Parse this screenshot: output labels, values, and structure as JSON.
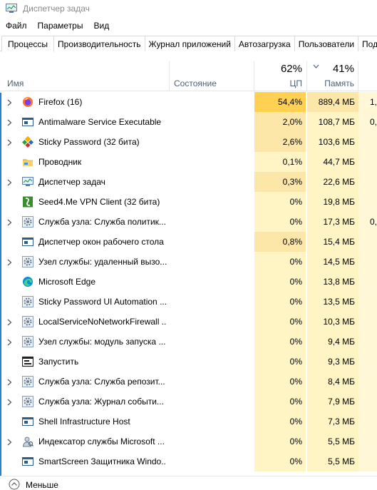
{
  "window": {
    "title": "Диспетчер задач",
    "icon": "task-manager-icon"
  },
  "menu": [
    {
      "label": "Файл"
    },
    {
      "label": "Параметры"
    },
    {
      "label": "Вид"
    }
  ],
  "tabs": [
    {
      "label": "Процессы",
      "active": true
    },
    {
      "label": "Производительность"
    },
    {
      "label": "Журнал приложений"
    },
    {
      "label": "Автозагрузка"
    },
    {
      "label": "Пользователи"
    },
    {
      "label": "Под"
    }
  ],
  "columns": {
    "name": "Имя",
    "status": "Состояние",
    "cpu_total": "62%",
    "cpu_label": "ЦП",
    "mem_total": "41%",
    "mem_label": "Память"
  },
  "colors": {
    "heat_high": "#ffd051",
    "heat_mid": "#fde7a8",
    "heat_low": "#fff4c4",
    "heat_edge": "#fff7d6"
  },
  "processes": [
    {
      "name": "Firefox (16)",
      "expandable": true,
      "icon": "firefox-icon",
      "cpu": "54,4%",
      "mem": "889,4 МБ",
      "extra": "1,",
      "cpu_heat": "high",
      "mem_heat": "mid"
    },
    {
      "name": "Antimalware Service Executable",
      "expandable": true,
      "icon": "service-window-icon",
      "cpu": "2,0%",
      "mem": "108,7 МБ",
      "extra": "0,",
      "cpu_heat": "mid",
      "mem_heat": "low"
    },
    {
      "name": "Sticky Password (32 бита)",
      "expandable": true,
      "icon": "sticky-password-icon",
      "cpu": "2,6%",
      "mem": "103,6 МБ",
      "extra": "",
      "cpu_heat": "mid",
      "mem_heat": "low"
    },
    {
      "name": "Проводник",
      "expandable": false,
      "icon": "folder-icon",
      "cpu": "0,1%",
      "mem": "44,7 МБ",
      "extra": "",
      "cpu_heat": "low",
      "mem_heat": "low"
    },
    {
      "name": "Диспетчер задач",
      "expandable": true,
      "icon": "task-manager-icon",
      "cpu": "0,3%",
      "mem": "22,6 МБ",
      "extra": "",
      "cpu_heat": "mid",
      "mem_heat": "low"
    },
    {
      "name": "Seed4.Me VPN Client (32 бита)",
      "expandable": false,
      "icon": "vpn-client-icon",
      "cpu": "0%",
      "mem": "19,8 МБ",
      "extra": "",
      "cpu_heat": "low",
      "mem_heat": "low"
    },
    {
      "name": "Служба узла: Служба политик...",
      "expandable": true,
      "icon": "gear-icon",
      "cpu": "0%",
      "mem": "17,3 МБ",
      "extra": "0,",
      "cpu_heat": "low",
      "mem_heat": "low"
    },
    {
      "name": "Диспетчер окон рабочего стола",
      "expandable": false,
      "icon": "service-window-icon",
      "cpu": "0,8%",
      "mem": "15,4 МБ",
      "extra": "",
      "cpu_heat": "mid",
      "mem_heat": "low"
    },
    {
      "name": "Узел службы: удаленный вызо...",
      "expandable": true,
      "icon": "gear-icon",
      "cpu": "0%",
      "mem": "14,5 МБ",
      "extra": "",
      "cpu_heat": "low",
      "mem_heat": "low"
    },
    {
      "name": "Microsoft Edge",
      "expandable": false,
      "icon": "edge-icon",
      "cpu": "0%",
      "mem": "13,8 МБ",
      "extra": "",
      "cpu_heat": "low",
      "mem_heat": "low"
    },
    {
      "name": "Sticky Password UI Automation ...",
      "expandable": false,
      "icon": "gear-icon",
      "cpu": "0%",
      "mem": "13,5 МБ",
      "extra": "",
      "cpu_heat": "low",
      "mem_heat": "low"
    },
    {
      "name": "LocalServiceNoNetworkFirewall ...",
      "expandable": true,
      "icon": "gear-icon",
      "cpu": "0%",
      "mem": "10,3 МБ",
      "extra": "",
      "cpu_heat": "low",
      "mem_heat": "low"
    },
    {
      "name": "Узел службы: модуль запуска ...",
      "expandable": true,
      "icon": "gear-icon",
      "cpu": "0%",
      "mem": "9,4 МБ",
      "extra": "",
      "cpu_heat": "low",
      "mem_heat": "low"
    },
    {
      "name": "Запустить",
      "expandable": false,
      "icon": "run-dialog-icon",
      "cpu": "0%",
      "mem": "9,3 МБ",
      "extra": "",
      "cpu_heat": "low",
      "mem_heat": "low"
    },
    {
      "name": "Служба узла: Служба репозит...",
      "expandable": true,
      "icon": "gear-icon",
      "cpu": "0%",
      "mem": "8,4 МБ",
      "extra": "",
      "cpu_heat": "low",
      "mem_heat": "low"
    },
    {
      "name": "Служба узла: Журнал событи...",
      "expandable": true,
      "icon": "gear-icon",
      "cpu": "0%",
      "mem": "7,9 МБ",
      "extra": "",
      "cpu_heat": "low",
      "mem_heat": "low"
    },
    {
      "name": "Shell Infrastructure Host",
      "expandable": false,
      "icon": "service-window-icon",
      "cpu": "0%",
      "mem": "7,3 МБ",
      "extra": "",
      "cpu_heat": "low",
      "mem_heat": "low"
    },
    {
      "name": "Индексатор службы Microsoft ...",
      "expandable": true,
      "icon": "indexer-user-icon",
      "cpu": "0%",
      "mem": "5,5 МБ",
      "extra": "",
      "cpu_heat": "low",
      "mem_heat": "low"
    },
    {
      "name": "SmartScreen Защитника Windo...",
      "expandable": false,
      "icon": "service-window-icon",
      "cpu": "0%",
      "mem": "5,5 МБ",
      "extra": "",
      "cpu_heat": "low",
      "mem_heat": "low"
    }
  ],
  "footer": {
    "label": "Меньше"
  }
}
